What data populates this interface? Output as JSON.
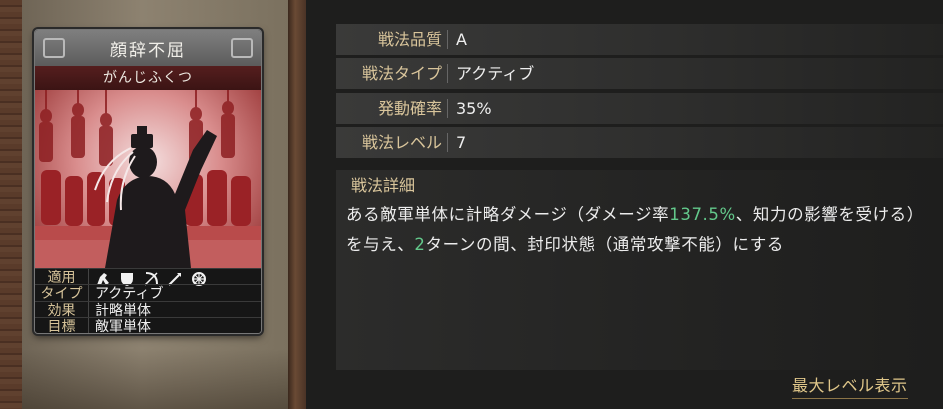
{
  "card": {
    "name": "顔辞不屈",
    "reading": "がんじふくつ",
    "info": {
      "apply_label": "適用",
      "type_label": "タイプ",
      "type_value": "アクティブ",
      "effect_label": "効果",
      "effect_value": "計略単体",
      "target_label": "目標",
      "target_value": "敵軍単体"
    },
    "unit_icons": [
      "cavalry-icon",
      "shield-icon",
      "bow-icon",
      "spear-icon",
      "wheel-icon"
    ]
  },
  "stats": [
    {
      "label": "戦法品質",
      "value": "A"
    },
    {
      "label": "戦法タイプ",
      "value": "アクティブ"
    },
    {
      "label": "発動確率",
      "value": "35%"
    },
    {
      "label": "戦法レベル",
      "value": "7"
    }
  ],
  "detail": {
    "label": "戦法詳細",
    "text_1": "ある敵軍単体に計略ダメージ（ダメージ率",
    "hl_1": "137.5%",
    "text_2": "、知力の影響を受ける）を与え、",
    "hl_2": "2",
    "text_3": "ターンの間、封印状態（通常攻撃不能）にする"
  },
  "max_level_link": "最大レベル表示",
  "colors": {
    "label_gold": "#d9c59b",
    "highlight_green": "#63c98b",
    "card_red": "#9c3a3a"
  }
}
